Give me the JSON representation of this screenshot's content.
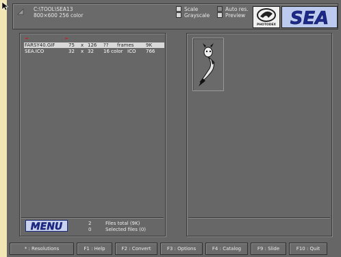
{
  "header": {
    "path": "C:\\TOOL\\SEA13",
    "mode": "800×600  256 color",
    "options": [
      {
        "label": "Scale",
        "checked": false
      },
      {
        "label": "Grayscale",
        "checked": false
      },
      {
        "label": "Auto res.",
        "checked": false
      },
      {
        "label": "Preview",
        "checked": false
      }
    ],
    "logo_photodex_text": "PHOTODEX",
    "logo_sea_text": "SEA"
  },
  "files": [
    {
      "name": "FARSY40.GIF",
      "w": "75",
      "x": "x",
      "h": "126",
      "colors": "??",
      "type": "frames",
      "size": "9K",
      "selected": true
    },
    {
      "name": "SEA.ICO",
      "w": "32",
      "x": "x",
      "h": "32",
      "colors": "16 color",
      "type": "ICO",
      "size": "766",
      "selected": false
    }
  ],
  "stats": {
    "menu_label": "MENU",
    "files_total_count": "2",
    "files_total_label": "Files total (9K)",
    "selected_count": "0",
    "selected_label": "Selected files (0)"
  },
  "function_keys": [
    {
      "label": "* : Resolutions"
    },
    {
      "label": "F1 : Help"
    },
    {
      "label": "F2 : Convert"
    },
    {
      "label": "F3 : Options"
    },
    {
      "label": "F4 : Catalog"
    },
    {
      "label": "F9 : Slide"
    },
    {
      "label": "F10 : Quit"
    }
  ],
  "colors": {
    "background": "#666666",
    "selection": "#d9d9d9",
    "marker": "#b03030"
  }
}
